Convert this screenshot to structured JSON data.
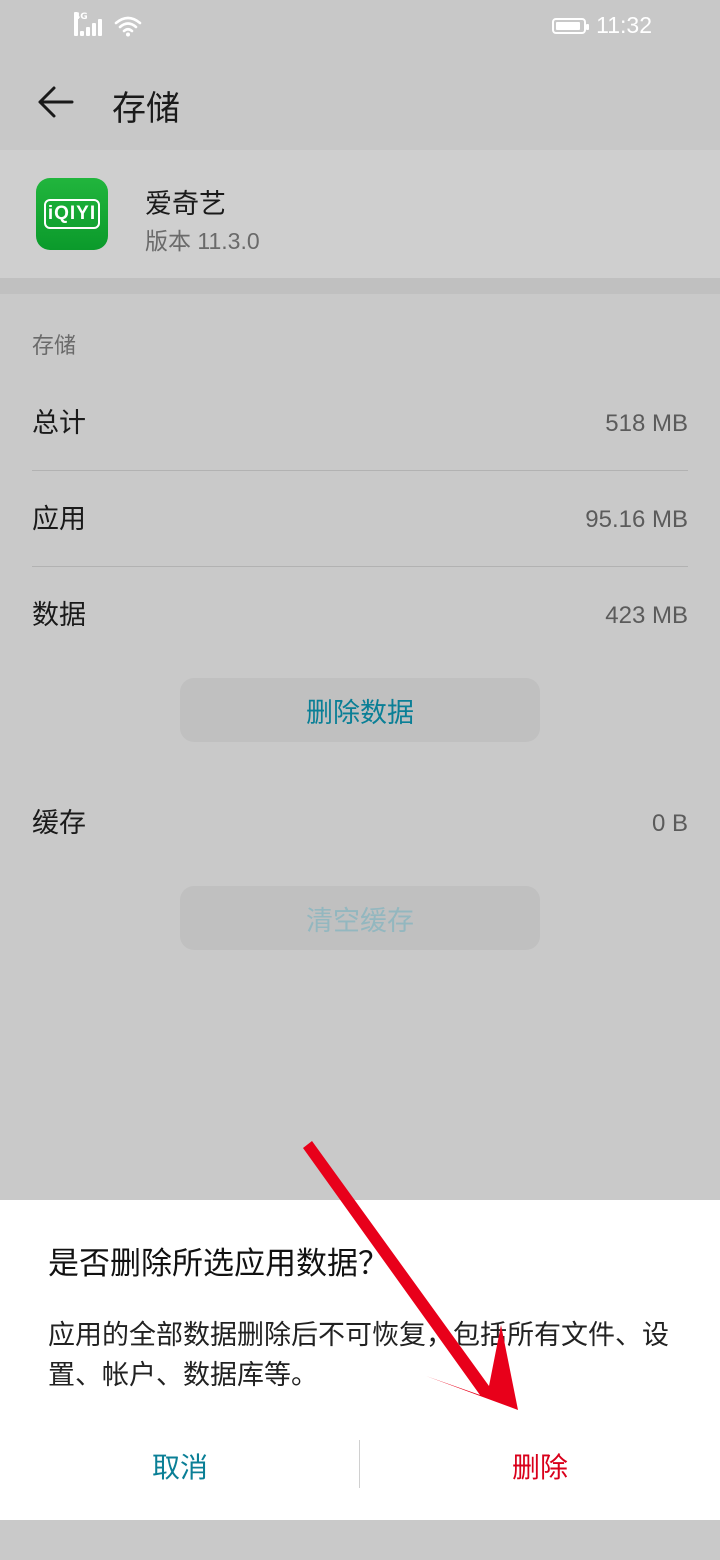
{
  "status_bar": {
    "time": "11:32",
    "network_label": "4G"
  },
  "header": {
    "title": "存储"
  },
  "app": {
    "name": "爱奇艺",
    "version": "版本 11.3.0",
    "icon_text": "iQIYI"
  },
  "storage": {
    "section_label": "存储",
    "rows": [
      {
        "label": "总计",
        "value": "518 MB"
      },
      {
        "label": "应用",
        "value": "95.16 MB"
      },
      {
        "label": "数据",
        "value": "423 MB"
      }
    ],
    "clear_data_button": "删除数据",
    "cache": {
      "label": "缓存",
      "value": "0 B"
    },
    "clear_cache_button": "清空缓存"
  },
  "dialog": {
    "title": "是否删除所选应用数据？",
    "message": "应用的全部数据删除后不可恢复，包括所有文件、设置、帐户、数据库等。",
    "cancel_label": "取消",
    "delete_label": "删除"
  },
  "colors": {
    "accent": "#0a7f96",
    "danger": "#d9001b",
    "disabled_accent": "#93b7bf",
    "arrow": "#e8001a"
  }
}
